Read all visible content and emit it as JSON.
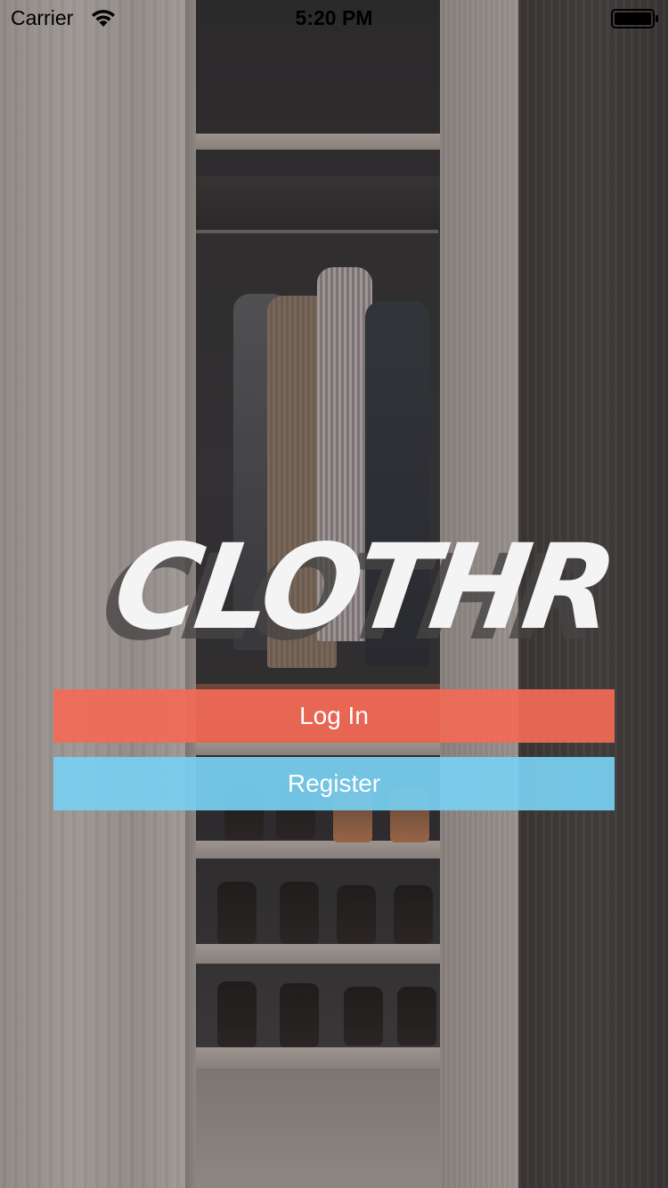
{
  "status_bar": {
    "carrier": "Carrier",
    "time": "5:20 PM",
    "wifi_icon": "wifi-icon",
    "battery_icon": "battery-icon"
  },
  "logo": {
    "text": "CLOTHR"
  },
  "actions": {
    "login_label": "Log In",
    "register_label": "Register"
  },
  "colors": {
    "login_button": "#F26A56",
    "register_button": "#79CFF0",
    "logo": "#F4F4F4"
  },
  "background_image": "wardrobe-photo"
}
